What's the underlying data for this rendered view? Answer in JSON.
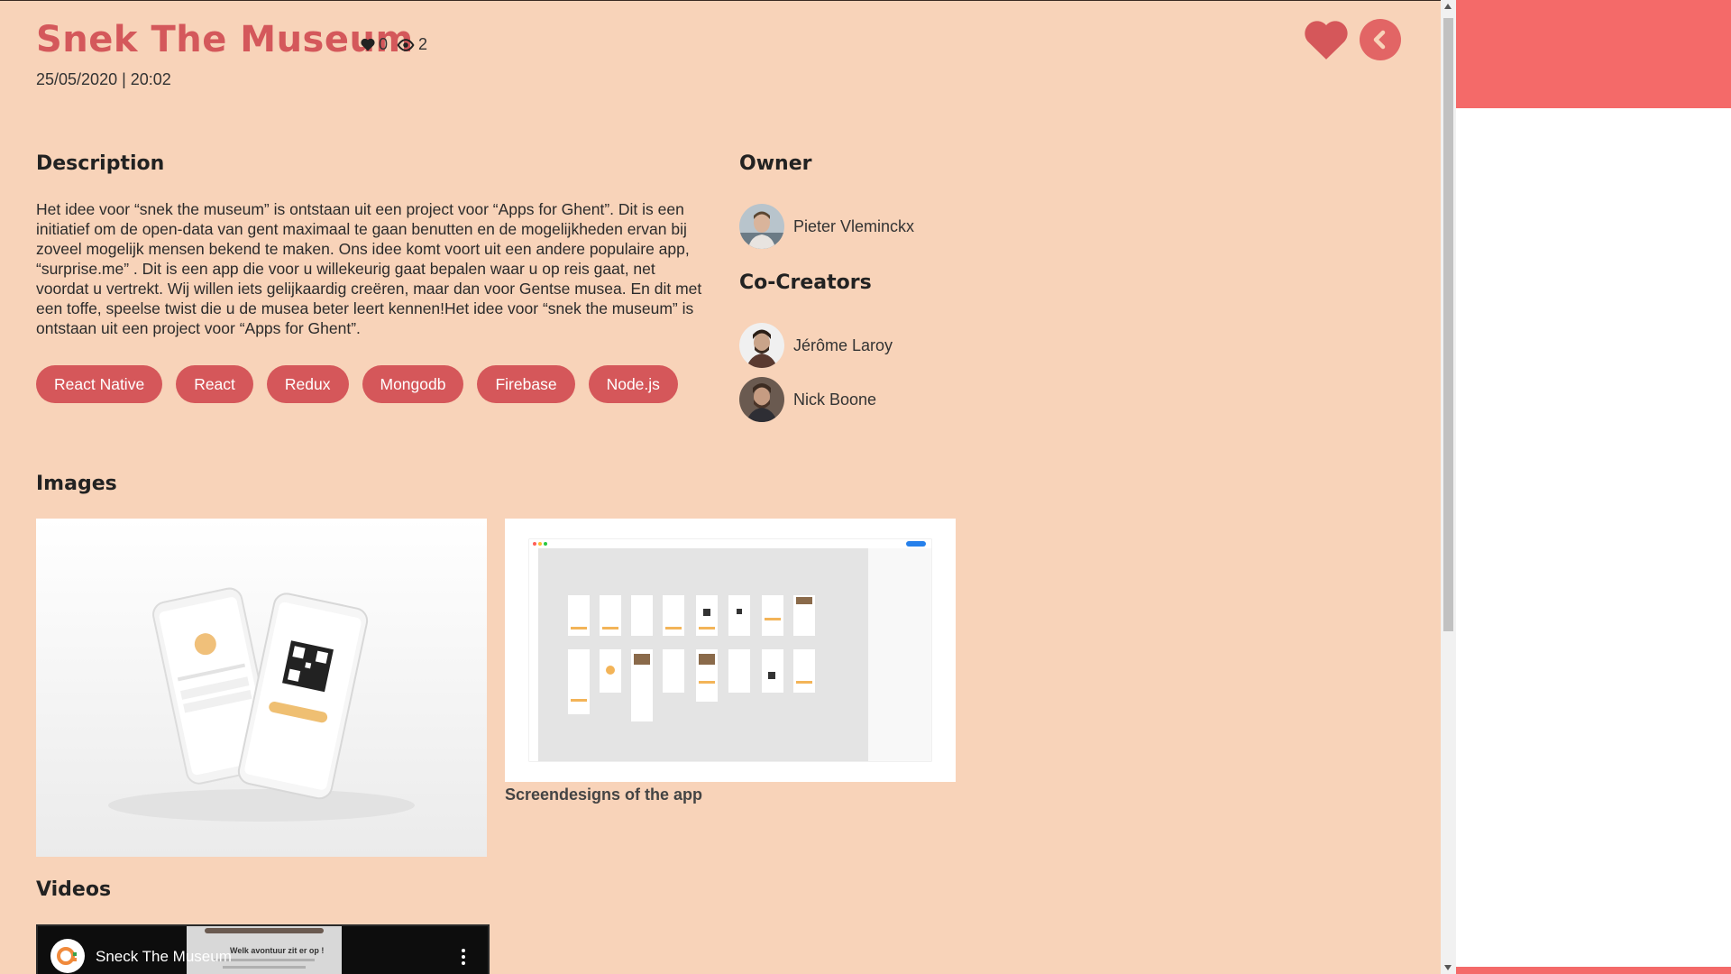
{
  "project": {
    "title": "Snek The Museum",
    "likes": "0",
    "views": "2",
    "date": "25/05/2020 | 20:02"
  },
  "colors": {
    "background": "#f8d3b9",
    "accent": "#d4585b",
    "tag": "#d5575a",
    "panel_accent": "#f46a69"
  },
  "icons": {
    "like_stat": "heart-icon",
    "view_stat": "eye-icon",
    "favorite": "heart-icon",
    "back": "chevron-left-icon",
    "video_menu": "more-vertical-icon"
  },
  "description": {
    "title": "Description",
    "text": "Het idee voor “snek the museum” is ontstaan uit een project voor “Apps for Ghent”. Dit is een initiatief om de open-data van gent maximaal te gaan benutten en de mogelijkheden ervan bij zoveel mogelijk mensen bekend te maken. Ons idee komt voort uit een andere populaire app, “surprise.me” . Dit is een app die voor u willekeurig gaat bepalen waar u op reis gaat, net voordat u vertrekt. Wij willen iets gelijkaardig creëren, maar dan voor Gentse musea. En dit met een toffe, speelse twist die u de musea beter leert kennen!Het idee voor “snek the museum” is ontstaan uit een project voor “Apps for Ghent”."
  },
  "tags": [
    "React Native",
    "React",
    "Redux",
    "Mongodb",
    "Firebase",
    "Node.js"
  ],
  "owner": {
    "title": "Owner",
    "name": "Pieter Vleminckx"
  },
  "co_creators": {
    "title": "Co-Creators",
    "people": [
      "Jérôme Laroy",
      "Nick Boone"
    ]
  },
  "images": {
    "title": "Images",
    "caption": "Screendesigns of the app"
  },
  "videos": {
    "title": "Videos",
    "video_title": "Sneck The Museum",
    "thumb_text": "Welk avontuur zit er op !"
  }
}
